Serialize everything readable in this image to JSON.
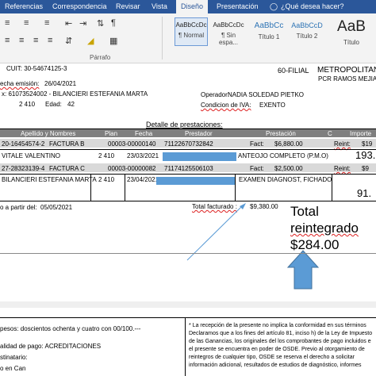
{
  "ribbon": {
    "tabs": [
      "Referencias",
      "Correspondencia",
      "Revisar",
      "Vista",
      "Diseño",
      "Presentación"
    ],
    "search_placeholder": "¿Qué desea hacer?",
    "group_paragraph": "Párrafo",
    "styles": [
      {
        "sample": "AaBbCcDc",
        "name": "¶ Normal"
      },
      {
        "sample": "AaBbCcDc",
        "name": "¶ Sin espa..."
      },
      {
        "sample": "AaBbCc",
        "name": "Título 1"
      },
      {
        "sample": "AaBbCcD",
        "name": "Título 2"
      },
      {
        "sample": "AaB",
        "name": "Título"
      }
    ]
  },
  "doc": {
    "cuit": "CUIT: 30-54674125-3",
    "filial": "60-FILIAL",
    "metro": "METROPOLITAN",
    "ramos": "PCR RAMOS MEJIA",
    "fecha_emision_label": "echa emisión:",
    "fecha_emision": "26/04/2021",
    "afiliado": "x: 61073524002 - BILANCIERI ESTEFANIA MARTA",
    "operador_label": "Operador:",
    "operador": "NADIA SOLEDAD PIETKO",
    "plan": "2 410",
    "edad_label": "Edad:",
    "edad": "42",
    "iva_label": "Condicion de IVA:",
    "iva": "EXENTO",
    "detalle_title": "Detalle de prestaciones:",
    "headers": [
      "Apellido y Nombres",
      "Plan",
      "Fecha",
      "Prestador",
      "Prestación",
      "C",
      "Importe"
    ],
    "rows": [
      {
        "c1": "20-16454574-2",
        "c2": "FACTURA B",
        "c3": "00003-00000140",
        "c4": "71122670732842",
        "c5": "Fact:",
        "c6": "$6,880.00",
        "c7": "Reint:",
        "c8": "$19"
      },
      {
        "c1": "VITALE VALENTINO",
        "c2": "2 410",
        "c3": "23/03/2021",
        "c5": "ANTEOJO COMPLETO (P.M.O)",
        "c8": "193."
      },
      {
        "c1": "27-28323139-4",
        "c2": "FACTURA C",
        "c3": "00003-00000082",
        "c4": "71174125506103",
        "c5": "Fact:",
        "c6": "$2,500.00",
        "c7": "Reint:",
        "c8": "$9"
      },
      {
        "c1": "BILANCIERI ESTEFANIA MARTA",
        "c2": "2 410",
        "c3": "23/04/2021",
        "c5": "EXAMEN DIAGNOST, FICHADO",
        "c8": "91."
      }
    ],
    "pago_label": "o a partir del:",
    "pago_fecha": "05/05/2021",
    "total_fact_label": "Total facturado :",
    "total_fact": "$9,380.00",
    "total_reint_l1": "Total",
    "total_reint_l2": "reintegrado",
    "total_reint_l3": "$284.00",
    "pesos": "pesos: doscientos ochenta y cuatro con 00/100.---",
    "modalidad": "alidad de pago: ACREDITACIONES",
    "destinatario": "stinatario:",
    "cuenta": "o en Can",
    "legal_1": "La recepción de la presente no implica la conformidad en sus términos",
    "legal_2": "Declaramos que a los fines del artículo 81, inciso h) de la Ley de Impuesto",
    "legal_3": "de las Ganancias, los originales del los comprobantes de pago incluidos e",
    "legal_4": "el presente se encuentra en poder de OSDE. Previo al otorgamiento de",
    "legal_5": "reintegros de cualquier tipo, OSDE se reserva el derecho a solicitar",
    "legal_6": "información adicional, resultados de estudios de diagnóstico, informes"
  },
  "colors": {
    "ribbon": "#2b579a",
    "highlight": "#5b9bd5",
    "arrow": "#5b9bd5"
  }
}
